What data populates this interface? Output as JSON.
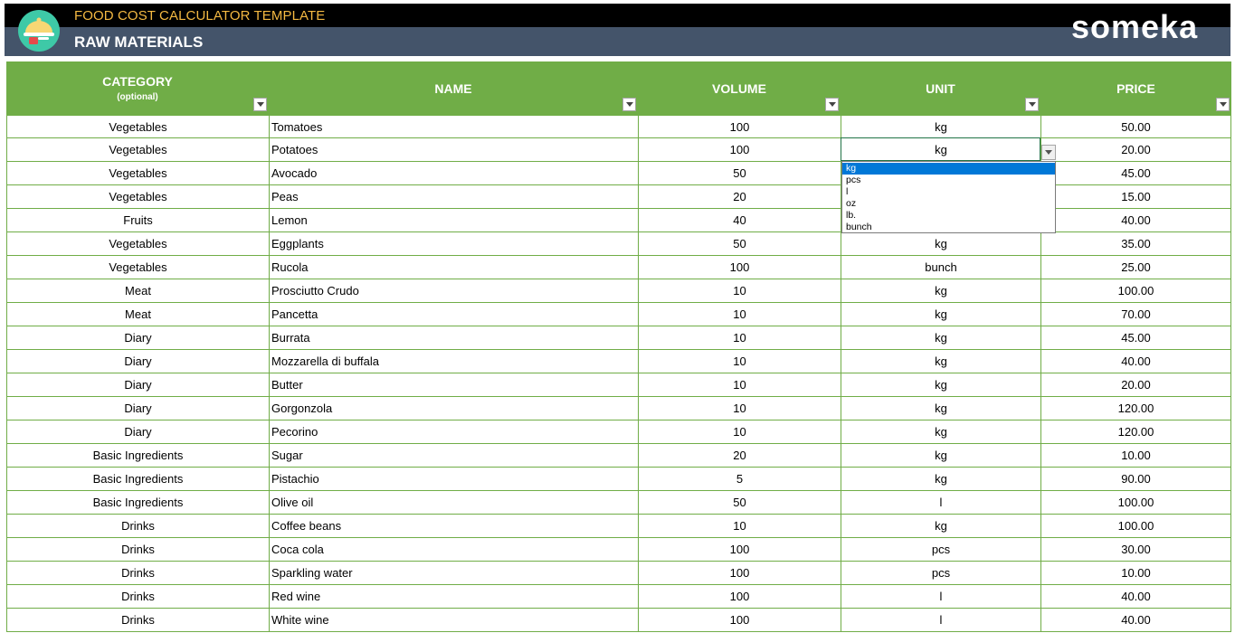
{
  "header": {
    "app_title": "FOOD COST CALCULATOR TEMPLATE",
    "sheet_title": "RAW MATERIALS",
    "brand": "someka",
    "logo_icon": "food-cloche-icon"
  },
  "columns": {
    "category": "CATEGORY",
    "category_sub": "(optional)",
    "name": "NAME",
    "volume": "VOLUME",
    "unit": "UNIT",
    "price": "PRICE"
  },
  "rows": [
    {
      "category": "Vegetables",
      "name": "Tomatoes",
      "volume": "100",
      "unit": "kg",
      "price": "50.00"
    },
    {
      "category": "Vegetables",
      "name": "Potatoes",
      "volume": "100",
      "unit": "kg",
      "price": "20.00"
    },
    {
      "category": "Vegetables",
      "name": "Avocado",
      "volume": "50",
      "unit": "",
      "price": "45.00"
    },
    {
      "category": "Vegetables",
      "name": "Peas",
      "volume": "20",
      "unit": "",
      "price": "15.00"
    },
    {
      "category": "Fruits",
      "name": "Lemon",
      "volume": "40",
      "unit": "",
      "price": "40.00"
    },
    {
      "category": "Vegetables",
      "name": "Eggplants",
      "volume": "50",
      "unit": "kg",
      "price": "35.00"
    },
    {
      "category": "Vegetables",
      "name": "Rucola",
      "volume": "100",
      "unit": "bunch",
      "price": "25.00"
    },
    {
      "category": "Meat",
      "name": "Prosciutto Crudo",
      "volume": "10",
      "unit": "kg",
      "price": "100.00"
    },
    {
      "category": "Meat",
      "name": "Pancetta",
      "volume": "10",
      "unit": "kg",
      "price": "70.00"
    },
    {
      "category": "Diary",
      "name": "Burrata",
      "volume": "10",
      "unit": "kg",
      "price": "45.00"
    },
    {
      "category": "Diary",
      "name": "Mozzarella di buffala",
      "volume": "10",
      "unit": "kg",
      "price": "40.00"
    },
    {
      "category": "Diary",
      "name": "Butter",
      "volume": "10",
      "unit": "kg",
      "price": "20.00"
    },
    {
      "category": "Diary",
      "name": "Gorgonzola",
      "volume": "10",
      "unit": "kg",
      "price": "120.00"
    },
    {
      "category": "Diary",
      "name": "Pecorino",
      "volume": "10",
      "unit": "kg",
      "price": "120.00"
    },
    {
      "category": "Basic Ingredients",
      "name": "Sugar",
      "volume": "20",
      "unit": "kg",
      "price": "10.00"
    },
    {
      "category": "Basic Ingredients",
      "name": "Pistachio",
      "volume": "5",
      "unit": "kg",
      "price": "90.00"
    },
    {
      "category": "Basic Ingredients",
      "name": "Olive oil",
      "volume": "50",
      "unit": "l",
      "price": "100.00"
    },
    {
      "category": "Drinks",
      "name": "Coffee beans",
      "volume": "10",
      "unit": "kg",
      "price": "100.00"
    },
    {
      "category": "Drinks",
      "name": "Coca cola",
      "volume": "100",
      "unit": "pcs",
      "price": "30.00"
    },
    {
      "category": "Drinks",
      "name": "Sparkling water",
      "volume": "100",
      "unit": "pcs",
      "price": "10.00"
    },
    {
      "category": "Drinks",
      "name": "Red wine",
      "volume": "100",
      "unit": "l",
      "price": "40.00"
    },
    {
      "category": "Drinks",
      "name": "White wine",
      "volume": "100",
      "unit": "l",
      "price": "40.00"
    }
  ],
  "unit_dropdown": {
    "options": [
      "kg",
      "pcs",
      "l",
      "oz",
      "lb.",
      "bunch"
    ],
    "selected": "kg"
  },
  "colors": {
    "header_green": "#70ad47",
    "banner_black": "#000000",
    "banner_slate": "#44546a",
    "title_orange": "#f4b942",
    "selection_blue": "#0078d7"
  }
}
